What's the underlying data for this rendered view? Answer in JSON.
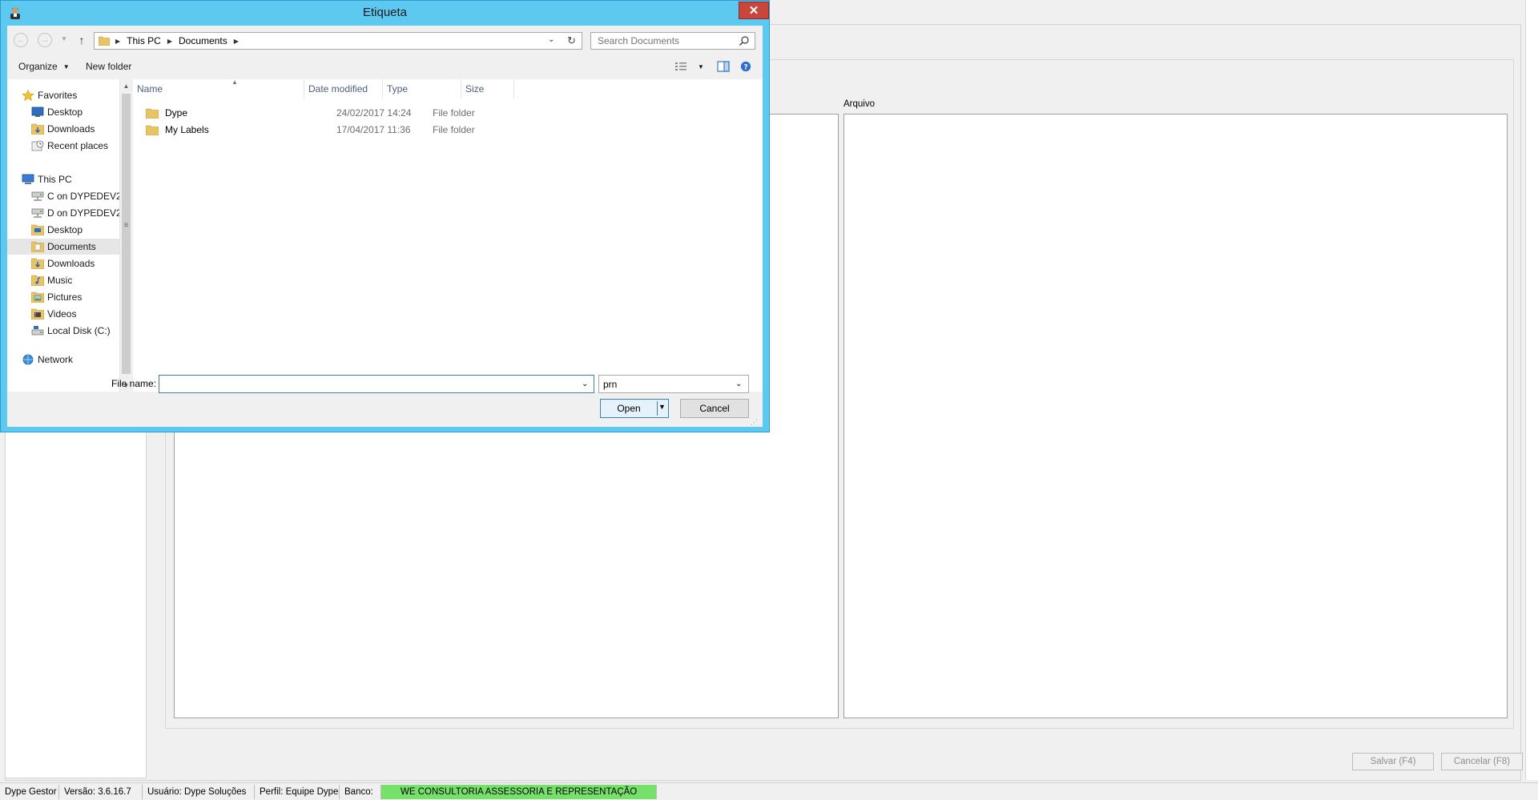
{
  "app": {
    "group_label_arquivo": "Arquivo",
    "save_label": "Salvar (F4)",
    "cancel_label": "Cancelar (F8)",
    "status": {
      "app_name": "Dype Gestor",
      "version": "Versão: 3.6.16.7",
      "user": "Usuário: Dype Soluções",
      "profile": "Perfil: Equipe Dype",
      "db_label": "Banco:",
      "db_value": "WE CONSULTORIA ASSESSORIA E REPRESENTAÇÃO",
      "db_color": "#76e06a"
    }
  },
  "dialog": {
    "title": "Etiqueta",
    "close_glyph": "✕",
    "address": {
      "crumbs": [
        "This PC",
        "Documents"
      ]
    },
    "search": {
      "placeholder": "Search Documents"
    },
    "toolbar": {
      "organize": "Organize",
      "new_folder": "New folder"
    },
    "nav": {
      "items": [
        {
          "label": "Favorites",
          "icon": "star-icon"
        },
        {
          "label": "Desktop",
          "icon": "desktop-icon"
        },
        {
          "label": "Downloads",
          "icon": "downloads-icon"
        },
        {
          "label": "Recent places",
          "icon": "recent-places-icon"
        },
        {
          "label": "This PC",
          "icon": "computer-icon"
        },
        {
          "label": "C on DYPEDEV20",
          "icon": "network-drive-icon"
        },
        {
          "label": "D on DYPEDEV20",
          "icon": "network-drive-icon"
        },
        {
          "label": "Desktop",
          "icon": "folder-icon"
        },
        {
          "label": "Documents",
          "icon": "folder-icon",
          "selected": true
        },
        {
          "label": "Downloads",
          "icon": "downloads-icon"
        },
        {
          "label": "Music",
          "icon": "music-icon"
        },
        {
          "label": "Pictures",
          "icon": "pictures-icon"
        },
        {
          "label": "Videos",
          "icon": "videos-icon"
        },
        {
          "label": "Local Disk (C:)",
          "icon": "disk-icon"
        },
        {
          "label": "Network",
          "icon": "network-icon"
        }
      ]
    },
    "columns": [
      "Name",
      "Date modified",
      "Type",
      "Size"
    ],
    "files": [
      {
        "name": "Dype",
        "date": "24/02/2017 14:24",
        "type": "File folder",
        "size": ""
      },
      {
        "name": "My Labels",
        "date": "17/04/2017 11:36",
        "type": "File folder",
        "size": ""
      }
    ],
    "file_name_label": "File name:",
    "file_name_value": "",
    "file_type": "prn",
    "open_label": "Open",
    "cancel_label": "Cancel"
  }
}
